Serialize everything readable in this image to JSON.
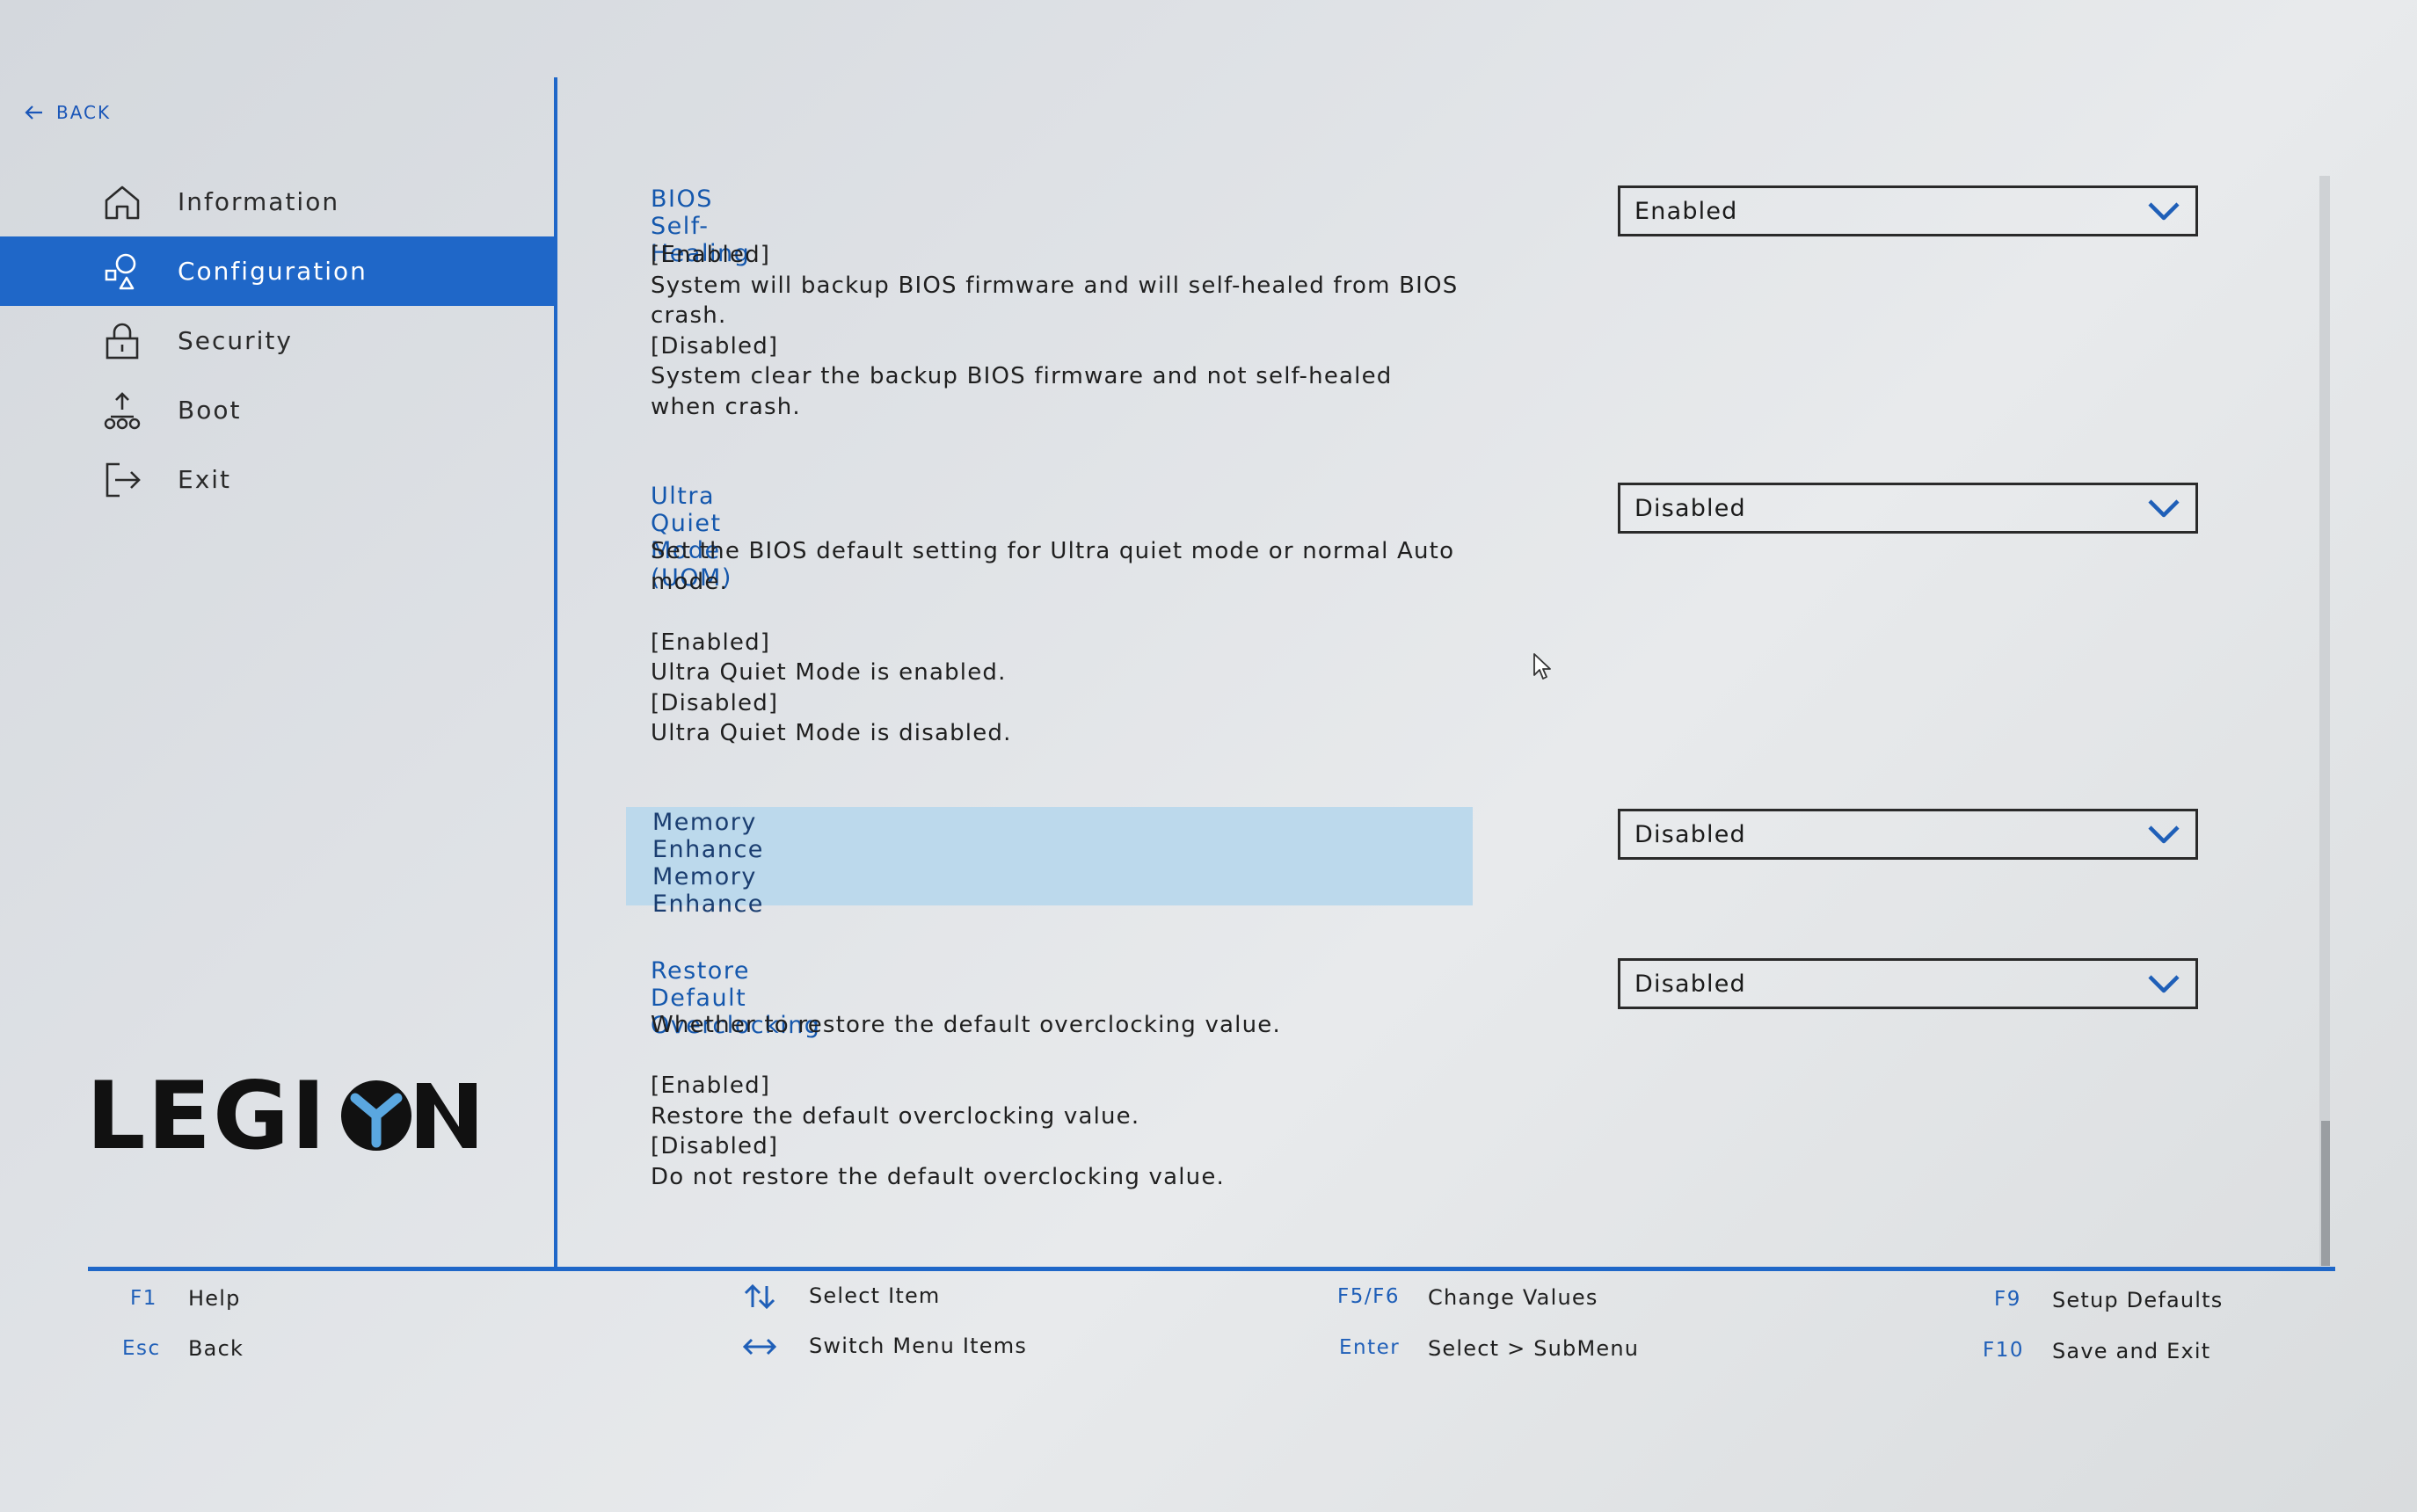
{
  "back_label": "BACK",
  "sidebar": {
    "items": [
      {
        "label": "Information",
        "icon": "home-icon",
        "active": false
      },
      {
        "label": "Configuration",
        "icon": "shapes-icon",
        "active": true
      },
      {
        "label": "Security",
        "icon": "lock-icon",
        "active": false
      },
      {
        "label": "Boot",
        "icon": "boot-icon",
        "active": false
      },
      {
        "label": "Exit",
        "icon": "exit-icon",
        "active": false
      }
    ]
  },
  "brand": {
    "logo_text": "LEGION"
  },
  "settings": [
    {
      "title": "BIOS Self-Healing",
      "description": "[Enabled]\nSystem will backup BIOS firmware and will self-healed from BIOS crash.\n[Disabled]\nSystem clear the backup BIOS firmware and not self-healed when crash.",
      "value": "Enabled"
    },
    {
      "title": "Ultra Quiet Mode (UQM)",
      "description": "Set the BIOS default setting for Ultra quiet mode or normal Auto mode.\n\n[Enabled]\nUltra Quiet Mode is enabled.\n[Disabled]\nUltra Quiet Mode is disabled.",
      "value": "Disabled"
    },
    {
      "title": "Memory Enhance",
      "description": "Memory Enhance",
      "value": "Disabled",
      "selected": true
    },
    {
      "title": "Restore Default Overclocking",
      "description": "Whether to restore the default overclocking value.\n\n[Enabled]\nRestore the default overclocking value.\n[Disabled]\nDo not restore the default overclocking value.",
      "value": "Disabled"
    }
  ],
  "footer": {
    "help_key": "F1",
    "help_label": "Help",
    "back_key": "Esc",
    "back_label": "Back",
    "select_item_label": "Select Item",
    "switch_menu_label": "Switch Menu Items",
    "change_key": "F5/F6",
    "change_label": "Change Values",
    "enter_key": "Enter",
    "enter_label": "Select > SubMenu",
    "defaults_key": "F9",
    "defaults_label": "Setup Defaults",
    "save_key": "F10",
    "save_label": "Save and Exit"
  },
  "colors": {
    "accent": "#1f67c8",
    "highlight": "#bcd9ec",
    "title": "#1457ad"
  }
}
